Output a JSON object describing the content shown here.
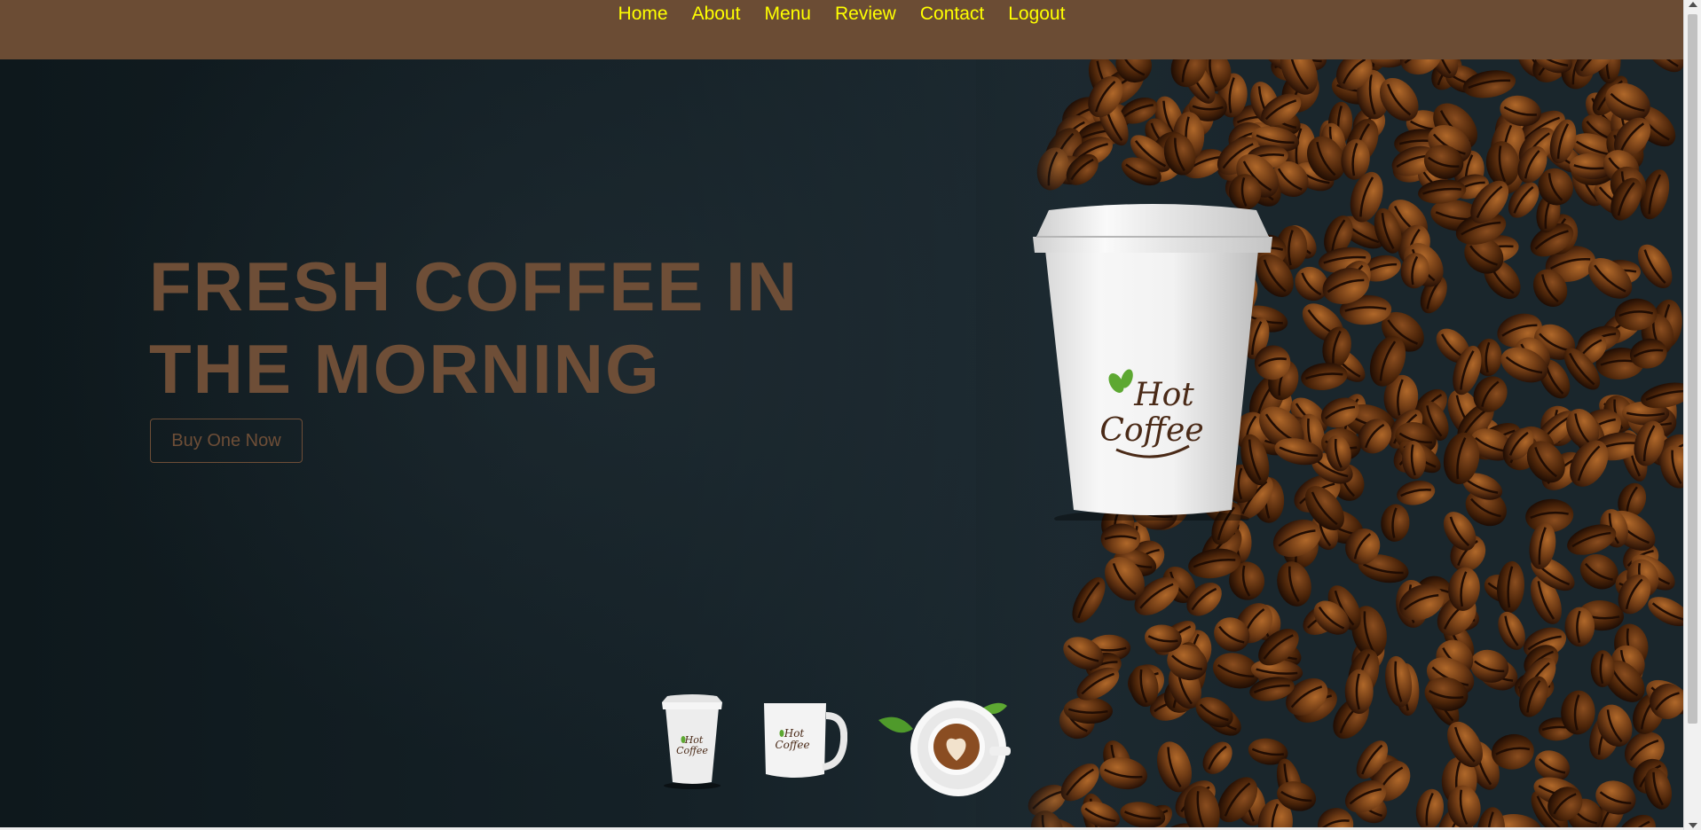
{
  "nav": {
    "items": [
      {
        "label": "Home"
      },
      {
        "label": "About"
      },
      {
        "label": "Menu"
      },
      {
        "label": "Review"
      },
      {
        "label": "Contact"
      },
      {
        "label": "Logout"
      }
    ]
  },
  "hero": {
    "title_line1": "FRESH COFFEE IN",
    "title_line2": "THE MORNING",
    "cta_label": "Buy One Now",
    "cup_logo_line1": "Hot",
    "cup_logo_line2": "Coffee"
  },
  "thumbnails": [
    {
      "icon": "paper-cup-icon",
      "logo_line1": "Hot",
      "logo_line2": "Coffee"
    },
    {
      "icon": "mug-icon",
      "logo_line1": "Hot",
      "logo_line2": "Coffee"
    },
    {
      "icon": "latte-cup-icon"
    }
  ],
  "colors": {
    "nav_bg": "#6b4c34",
    "nav_link": "#ffff00",
    "hero_text": "#6e4e37",
    "logo_text": "#4a2a17",
    "leaf_green": "#5da832"
  }
}
